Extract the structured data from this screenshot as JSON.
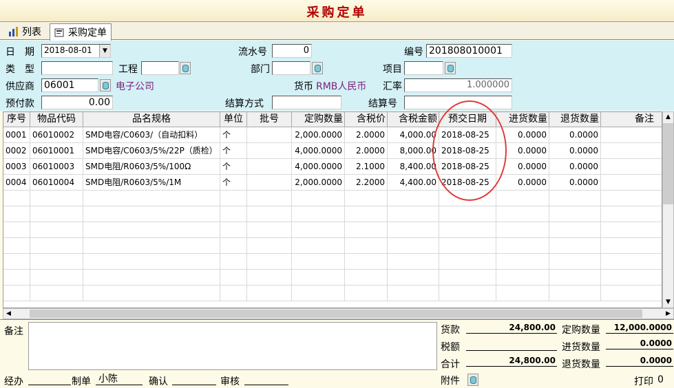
{
  "window": {
    "title": "采购定单"
  },
  "tabs": [
    {
      "label": "列表"
    },
    {
      "label": "采购定单"
    }
  ],
  "form": {
    "date_label": "日　期",
    "date_value": "2018-08-01",
    "serial_label": "流水号",
    "serial_value": "0",
    "number_label": "编号",
    "number_value": "201808010001",
    "type_label": "类　型",
    "type_value": "",
    "project_label": "工程",
    "project_value": "",
    "dept_label": "部门",
    "dept_value": "",
    "item_label": "项目",
    "item_value": "",
    "supplier_label": "供应商",
    "supplier_code": "06001",
    "supplier_name": "电子公司",
    "currency_label": "货币",
    "currency_value": "RMB人民币",
    "rate_label": "汇率",
    "rate_value": "1.000000",
    "prepay_label": "预付款",
    "prepay_value": "0.00",
    "settle_method_label": "结算方式",
    "settle_method_value": "",
    "settle_no_label": "结算号",
    "settle_no_value": ""
  },
  "table": {
    "columns": [
      "序号",
      "物品代码",
      "品名规格",
      "单位",
      "批号",
      "定购数量",
      "含税价",
      "含税金额",
      "预交日期",
      "进货数量",
      "退货数量",
      "备注"
    ],
    "rows": [
      {
        "seq": "0001",
        "code": "06010002",
        "name": "SMD电容/C0603/（自动扣料）",
        "unit": "个",
        "batch": "",
        "qty": "2,000.0000",
        "price": "2.0000",
        "amount": "4,000.00",
        "date": "2018-08-25",
        "in_qty": "0.0000",
        "ret_qty": "0.0000",
        "note": ""
      },
      {
        "seq": "0002",
        "code": "06010001",
        "name": "SMD电容/C0603/5%/22P（质检）",
        "unit": "个",
        "batch": "",
        "qty": "4,000.0000",
        "price": "2.0000",
        "amount": "8,000.00",
        "date": "2018-08-25",
        "in_qty": "0.0000",
        "ret_qty": "0.0000",
        "note": ""
      },
      {
        "seq": "0003",
        "code": "06010003",
        "name": "SMD电阻/R0603/5%/100Ω",
        "unit": "个",
        "batch": "",
        "qty": "4,000.0000",
        "price": "2.1000",
        "amount": "8,400.00",
        "date": "2018-08-25",
        "in_qty": "0.0000",
        "ret_qty": "0.0000",
        "note": ""
      },
      {
        "seq": "0004",
        "code": "06010004",
        "name": "SMD电阻/R0603/5%/1M",
        "unit": "个",
        "batch": "",
        "qty": "2,000.0000",
        "price": "2.2000",
        "amount": "4,400.00",
        "date": "2018-08-25",
        "in_qty": "0.0000",
        "ret_qty": "0.0000",
        "note": ""
      }
    ]
  },
  "footer": {
    "remark_label": "备注",
    "remark_value": "",
    "goods_label": "货款",
    "goods_value": "24,800.00",
    "tax_label": "税额",
    "tax_value": "",
    "total_label": "合计",
    "total_value": "24,800.00",
    "order_qty_label": "定购数量",
    "order_qty_value": "12,000.0000",
    "in_qty_label": "进货数量",
    "in_qty_value": "0.0000",
    "ret_qty_label": "退货数量",
    "ret_qty_value": "0.0000",
    "handler_label": "经办",
    "handler_value": "",
    "maker_label": "制单",
    "maker_value": "小陈",
    "confirm_label": "确认",
    "confirm_value": "",
    "audit_label": "审核",
    "audit_value": "",
    "attach_label": "附件",
    "print_label": "打印",
    "print_value": "0"
  },
  "colors": {
    "form_bg": "#d4f1f6",
    "title_text": "#b00000",
    "annotation_circle": "#e23a3a",
    "supplier_name": "#7a1f7a"
  }
}
